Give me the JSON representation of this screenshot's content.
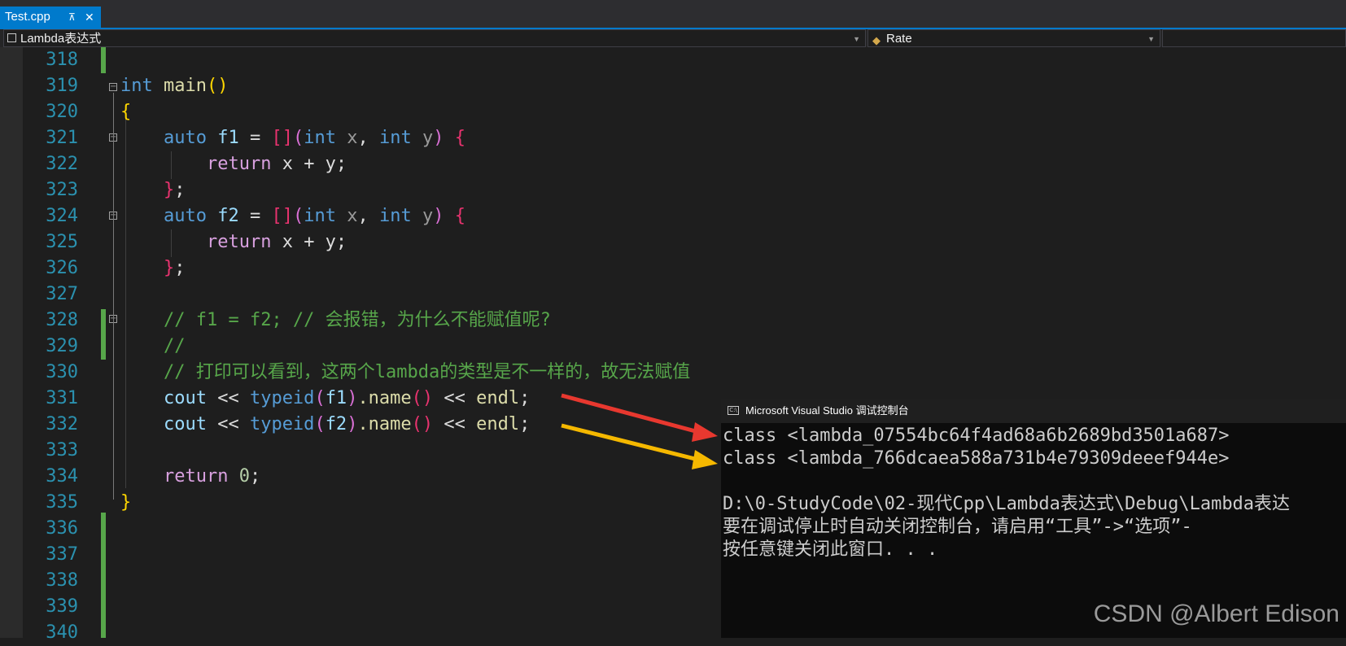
{
  "tab": {
    "filename": "Test.cpp",
    "pin_glyph": "⊼",
    "close_glyph": "✕"
  },
  "navbar": {
    "project": "Lambda表达式",
    "member": "Rate"
  },
  "editor": {
    "lines": [
      {
        "n": "318"
      },
      {
        "n": "319"
      },
      {
        "n": "320"
      },
      {
        "n": "321"
      },
      {
        "n": "322"
      },
      {
        "n": "323"
      },
      {
        "n": "324"
      },
      {
        "n": "325"
      },
      {
        "n": "326"
      },
      {
        "n": "327"
      },
      {
        "n": "328"
      },
      {
        "n": "329"
      },
      {
        "n": "330"
      },
      {
        "n": "331"
      },
      {
        "n": "332"
      },
      {
        "n": "333"
      },
      {
        "n": "334"
      },
      {
        "n": "335"
      },
      {
        "n": "336"
      },
      {
        "n": "337"
      },
      {
        "n": "338"
      },
      {
        "n": "339"
      },
      {
        "n": "340"
      }
    ],
    "code": {
      "l319_kw": "int",
      "l319_fn": "main",
      "l319_p": "()",
      "l320": "{",
      "l321_kw": "auto",
      "l321_var": "f1",
      "l321_eq": " = ",
      "l321_br": "[]",
      "l321_p1": "(",
      "l321_int1": "int",
      "l321_x": "x",
      "l321_comma": ", ",
      "l321_int2": "int",
      "l321_y": "y",
      "l321_p2": ")",
      "l321_ob": "{",
      "l322_ret": "return",
      "l322_rest": " x + y;",
      "l323_cb": "}",
      "l323_semi": ";",
      "l324_kw": "auto",
      "l324_var": "f2",
      "l324_eq": " = ",
      "l324_br": "[]",
      "l324_p1": "(",
      "l324_int1": "int",
      "l324_x": "x",
      "l324_comma": ", ",
      "l324_int2": "int",
      "l324_y": "y",
      "l324_p2": ")",
      "l324_ob": "{",
      "l325_ret": "return",
      "l325_rest": " x + y;",
      "l326_cb": "}",
      "l326_semi": ";",
      "l328": "// f1 = f2; // 会报错，为什么不能赋值呢?",
      "l329": "//",
      "l330": "// 打印可以看到，这两个lambda的类型是不一样的，故无法赋值",
      "l331_cout": "cout",
      "l331_op": " << ",
      "l331_typeid": "typeid",
      "l331_p1": "(",
      "l331_arg": "f1",
      "l331_p2": ")",
      "l331_name": ".name",
      "l331_np": "()",
      "l331_op2": " << ",
      "l331_endl": "endl",
      "l331_semi": ";",
      "l332_cout": "cout",
      "l332_op": " << ",
      "l332_typeid": "typeid",
      "l332_p1": "(",
      "l332_arg": "f2",
      "l332_p2": ")",
      "l332_name": ".name",
      "l332_np": "()",
      "l332_op2": " << ",
      "l332_endl": "endl",
      "l332_semi": ";",
      "l334_ret": "return",
      "l334_num": "0",
      "l334_semi": ";",
      "l335": "}"
    }
  },
  "console": {
    "title": "Microsoft Visual Studio 调试控制台",
    "icon_text": "C:\\",
    "lines": [
      "class <lambda_07554bc64f4ad68a6b2689bd3501a687>",
      "class <lambda_766dcaea588a731b4e79309deeef944e>",
      "",
      "D:\\0-StudyCode\\02-现代Cpp\\Lambda表达式\\Debug\\Lambda表达",
      "要在调试停止时自动关闭控制台，请启用“工具”->“选项”-",
      "按任意键关闭此窗口. . ."
    ]
  },
  "watermark": "CSDN @Albert Edison",
  "colors": {
    "arrow_red": "#e8382f",
    "arrow_yellow": "#f5b800",
    "tab_accent": "#007acc"
  }
}
